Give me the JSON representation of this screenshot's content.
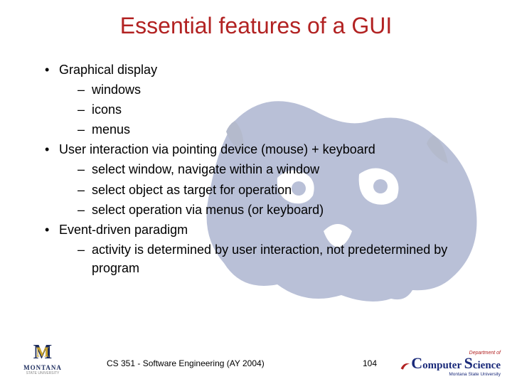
{
  "title": "Essential features of a GUI",
  "bullets": [
    {
      "text": "Graphical display",
      "sub": [
        "windows",
        "icons",
        "menus"
      ]
    },
    {
      "text": "User interaction via pointing device (mouse) + keyboard",
      "sub": [
        "select window, navigate within a window",
        "select object as target for operation",
        "select operation via menus (or keyboard)"
      ]
    },
    {
      "text": "Event-driven paradigm",
      "sub": [
        "activity is determined by user interaction, not predetermined by program"
      ]
    }
  ],
  "footer": {
    "course": "CS 351 - Software Engineering (AY 2004)",
    "page": "104",
    "left_logo": {
      "name": "MONTANA",
      "sub": "STATE UNIVERSITY"
    },
    "right_logo": {
      "dept": "Department of",
      "name_html": "Computer Science",
      "uni": "Montana State University"
    }
  }
}
